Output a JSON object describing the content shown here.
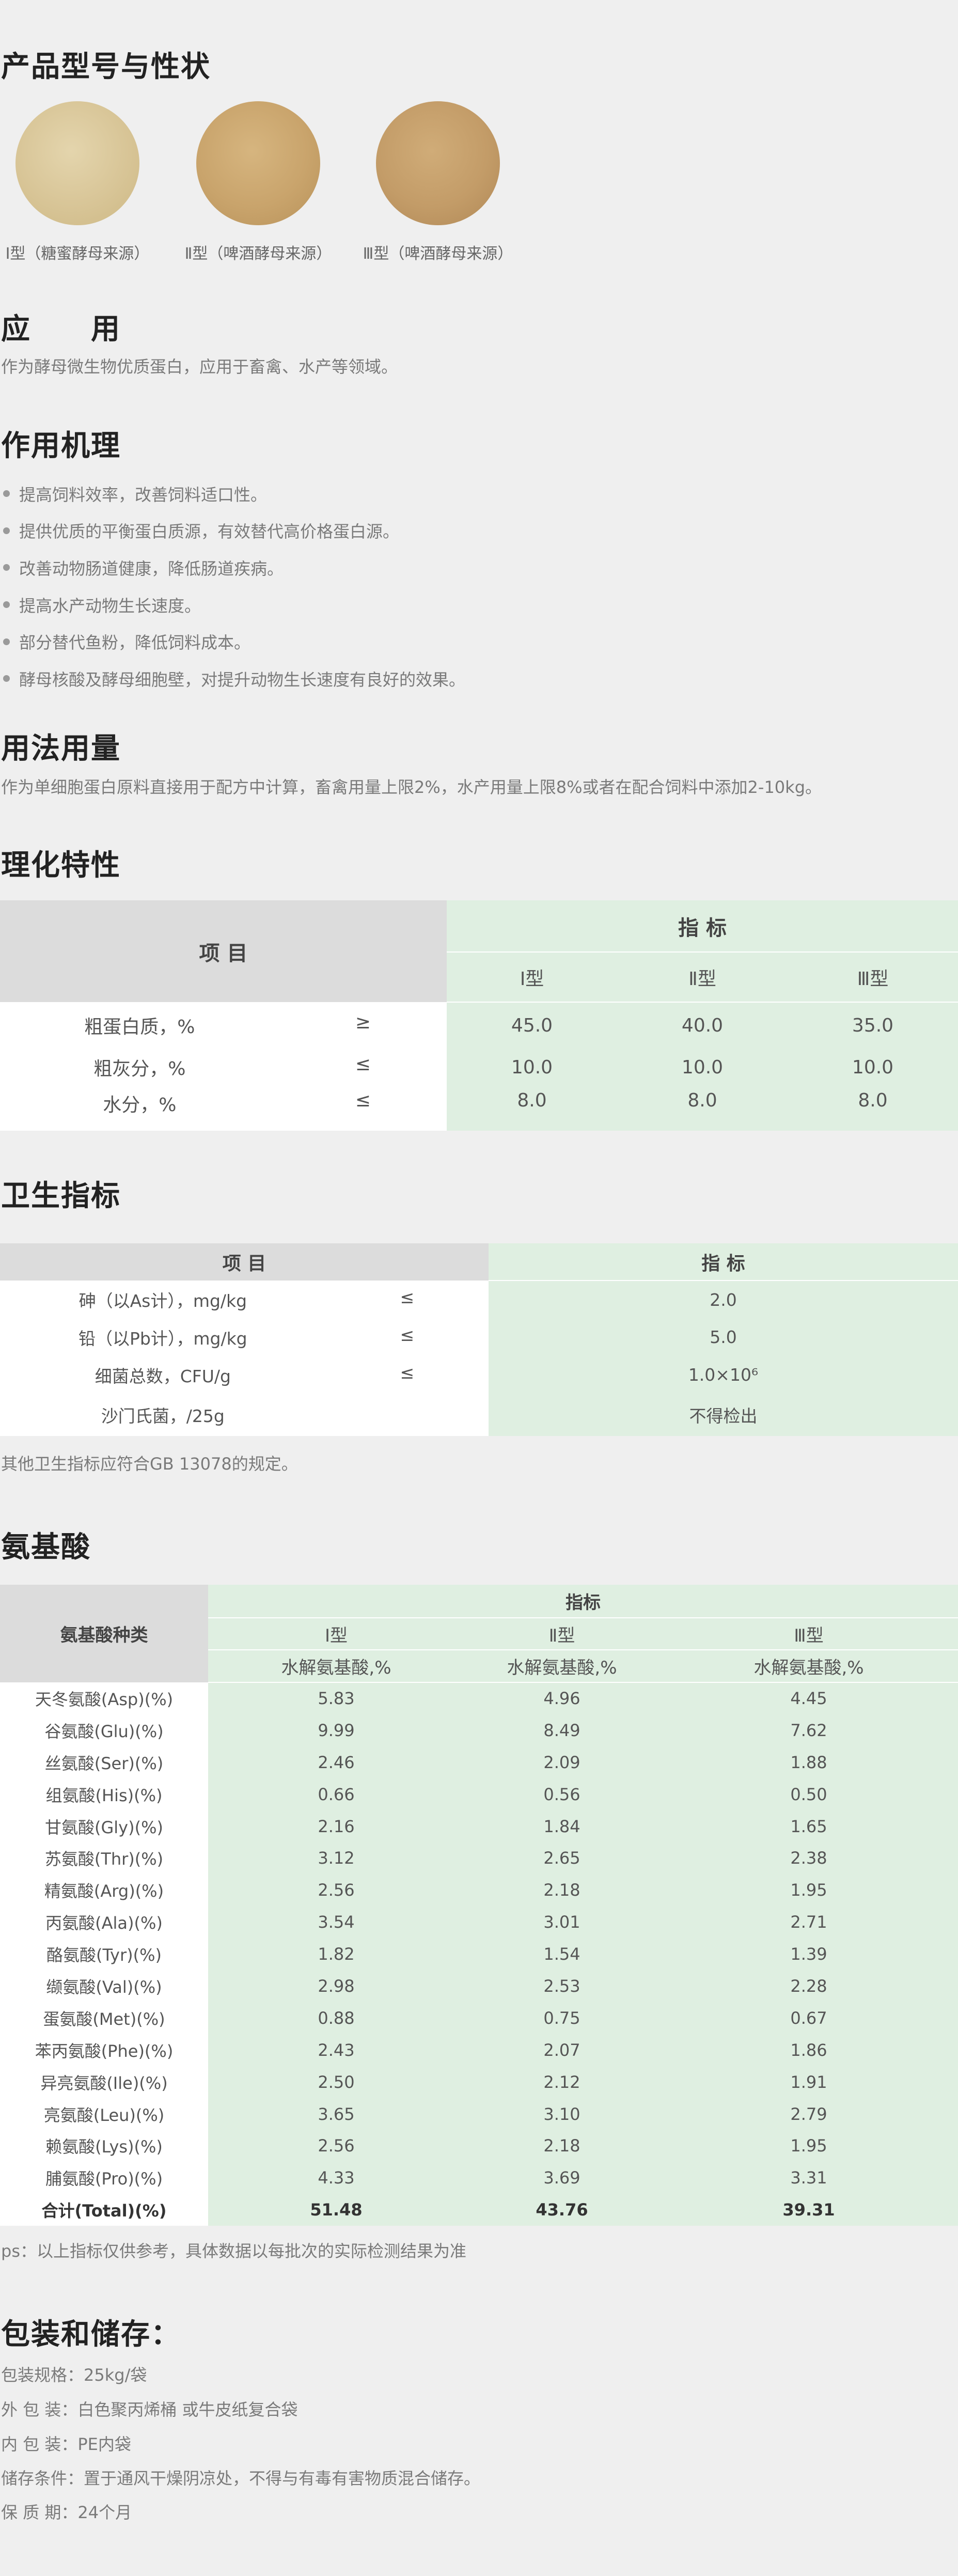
{
  "sections": {
    "product": "产品型号与性状",
    "application": "应　　用",
    "mechanism": "作用机理",
    "usage": "用法用量",
    "physchem": "理化特性",
    "hygiene": "卫生指标",
    "amino": "氨基酸",
    "packaging": "包装和储存："
  },
  "products": [
    {
      "label": "Ⅰ型（糖蜜酵母来源）",
      "color": "#d9c79a"
    },
    {
      "label": "Ⅱ型（啤酒酵母来源）",
      "color": "#c9a46c"
    },
    {
      "label": "Ⅲ型（啤酒酵母来源）",
      "color": "#c39c68"
    }
  ],
  "application_text": "作为酵母微生物优质蛋白，应用于畜禽、水产等领域。",
  "mechanism_items": [
    "提高饲料效率，改善饲料适口性。",
    "提供优质的平衡蛋白质源，有效替代高价格蛋白源。",
    "改善动物肠道健康，降低肠道疾病。",
    "提高水产动物生长速度。",
    "部分替代鱼粉，降低饲料成本。",
    "酵母核酸及酵母细胞壁，对提升动物生长速度有良好的效果。"
  ],
  "usage_text": "作为单细胞蛋白原料直接用于配方中计算，畜禽用量上限2%，水产用量上限8%或者在配合饲料中添加2-10kg。",
  "physchem_table": {
    "item_header": "项  目",
    "index_header": "指  标",
    "types": [
      "Ⅰ型",
      "Ⅱ型",
      "Ⅲ型"
    ],
    "rows": [
      {
        "name": "粗蛋白质，%",
        "op": "≥",
        "values": [
          "45.0",
          "40.0",
          "35.0"
        ]
      },
      {
        "name": "粗灰分，%",
        "op": "≤",
        "values": [
          "10.0",
          "10.0",
          "10.0"
        ]
      },
      {
        "name": "水分，%",
        "op": "≤",
        "values": [
          "8.0",
          "8.0",
          "8.0"
        ]
      }
    ]
  },
  "hygiene_table": {
    "item_header": "项  目",
    "index_header": "指  标",
    "rows": [
      {
        "name": "砷（以As计），mg/kg",
        "op": "≤",
        "value": "2.0"
      },
      {
        "name": "铅（以Pb计），mg/kg",
        "op": "≤",
        "value": "5.0"
      },
      {
        "name": "细菌总数，CFU/g",
        "op": "≤",
        "value": "1.0×10⁶"
      },
      {
        "name": "沙门氏菌，/25g",
        "op": "",
        "value": "不得检出"
      }
    ]
  },
  "hygiene_note": "其他卫生指标应符合GB 13078的规定。",
  "amino_table": {
    "item_header": "氨基酸种类",
    "index_header": "指标",
    "types": [
      "Ⅰ型",
      "Ⅱ型",
      "Ⅲ型"
    ],
    "subheader": "水解氨基酸,%",
    "rows": [
      {
        "name": "天冬氨酸(Asp)(%)",
        "values": [
          "5.83",
          "4.96",
          "4.45"
        ]
      },
      {
        "name": "谷氨酸(Glu)(%)",
        "values": [
          "9.99",
          "8.49",
          "7.62"
        ]
      },
      {
        "name": "丝氨酸(Ser)(%)",
        "values": [
          "2.46",
          "2.09",
          "1.88"
        ]
      },
      {
        "name": "组氨酸(His)(%)",
        "values": [
          "0.66",
          "0.56",
          "0.50"
        ]
      },
      {
        "name": "甘氨酸(Gly)(%)",
        "values": [
          "2.16",
          "1.84",
          "1.65"
        ]
      },
      {
        "name": "苏氨酸(Thr)(%)",
        "values": [
          "3.12",
          "2.65",
          "2.38"
        ]
      },
      {
        "name": "精氨酸(Arg)(%)",
        "values": [
          "2.56",
          "2.18",
          "1.95"
        ]
      },
      {
        "name": "丙氨酸(Ala)(%)",
        "values": [
          "3.54",
          "3.01",
          "2.71"
        ]
      },
      {
        "name": "酪氨酸(Tyr)(%)",
        "values": [
          "1.82",
          "1.54",
          "1.39"
        ]
      },
      {
        "name": "缬氨酸(Val)(%)",
        "values": [
          "2.98",
          "2.53",
          "2.28"
        ]
      },
      {
        "name": "蛋氨酸(Met)(%)",
        "values": [
          "0.88",
          "0.75",
          "0.67"
        ]
      },
      {
        "name": "苯丙氨酸(Phe)(%)",
        "values": [
          "2.43",
          "2.07",
          "1.86"
        ]
      },
      {
        "name": "异亮氨酸(Ile)(%)",
        "values": [
          "2.50",
          "2.12",
          "1.91"
        ]
      },
      {
        "name": "亮氨酸(Leu)(%)",
        "values": [
          "3.65",
          "3.10",
          "2.79"
        ]
      },
      {
        "name": "赖氨酸(Lys)(%)",
        "values": [
          "2.56",
          "2.18",
          "1.95"
        ]
      },
      {
        "name": "脯氨酸(Pro)(%)",
        "values": [
          "4.33",
          "3.69",
          "3.31"
        ]
      }
    ],
    "total": {
      "name": "合计(Total)(%)",
      "values": [
        "51.48",
        "43.76",
        "39.31"
      ]
    }
  },
  "amino_note": "ps：以上指标仅供参考，具体数据以每批次的实际检测结果为准",
  "packaging_lines": [
    "包装规格：25kg/袋",
    "外  包  装：白色聚丙烯桶 或牛皮纸复合袋",
    "内  包  装：PE内袋",
    "储存条件：置于通风干燥阴凉处，不得与有毒有害物质混合储存。",
    "保  质  期：24个月"
  ],
  "colors": {
    "green_cell": "#dfefe1",
    "gray_header": "#dcdcdc",
    "page_bg": "#efefef"
  }
}
